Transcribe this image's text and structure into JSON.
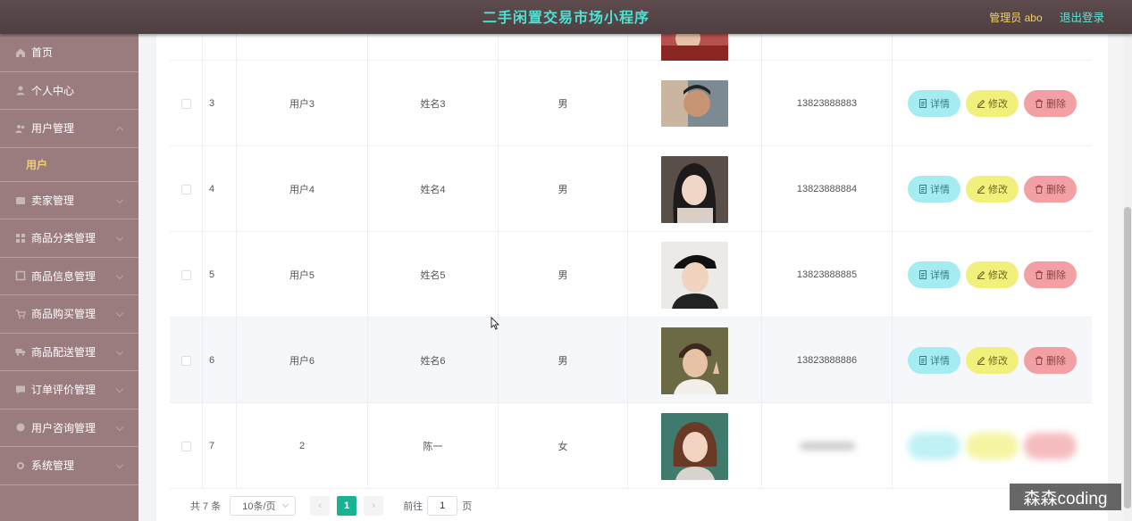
{
  "header": {
    "title": "二手闲置交易市场小程序",
    "admin_label": "管理员 abo",
    "logout": "退出登录"
  },
  "sidebar": {
    "items": [
      {
        "label": "首页",
        "icon": "home-icon"
      },
      {
        "label": "个人中心",
        "icon": "user-icon"
      },
      {
        "label": "用户管理",
        "icon": "users-icon"
      },
      {
        "label": "卖家管理",
        "icon": "seller-icon"
      },
      {
        "label": "商品分类管理",
        "icon": "category-icon"
      },
      {
        "label": "商品信息管理",
        "icon": "goods-icon"
      },
      {
        "label": "商品购买管理",
        "icon": "cart-icon"
      },
      {
        "label": "商品配送管理",
        "icon": "truck-icon"
      },
      {
        "label": "订单评价管理",
        "icon": "comment-icon"
      },
      {
        "label": "用户咨询管理",
        "icon": "chat-icon"
      },
      {
        "label": "系统管理",
        "icon": "settings-icon"
      }
    ],
    "subitem": "用户"
  },
  "table": {
    "rows": [
      {
        "idx": "3",
        "account": "用户3",
        "name": "姓名3",
        "sex": "男",
        "phone": "13823888883"
      },
      {
        "idx": "4",
        "account": "用户4",
        "name": "姓名4",
        "sex": "男",
        "phone": "13823888884"
      },
      {
        "idx": "5",
        "account": "用户5",
        "name": "姓名5",
        "sex": "男",
        "phone": "13823888885"
      },
      {
        "idx": "6",
        "account": "用户6",
        "name": "姓名6",
        "sex": "男",
        "phone": "13823888886"
      },
      {
        "idx": "7",
        "account": "2",
        "name": "陈一",
        "sex": "女",
        "phone": ""
      }
    ],
    "actions": {
      "detail": "详情",
      "edit": "修改",
      "delete": "删除"
    }
  },
  "pagination": {
    "total": "共 7 条",
    "page_size": "10条/页",
    "current_page": "1",
    "goto_prefix": "前往",
    "goto_value": "1",
    "goto_suffix": "页"
  },
  "watermark": "森森coding",
  "colors": {
    "header_bg": "#4e3f41",
    "title": "#4fe0d3",
    "sidebar_bg": "#9a7c7f",
    "active_sub": "#f1cf6b",
    "detail_btn": "#a4ecf1",
    "edit_btn": "#f1f07b",
    "delete_btn": "#f2a0a4",
    "page_active": "#19b394"
  }
}
